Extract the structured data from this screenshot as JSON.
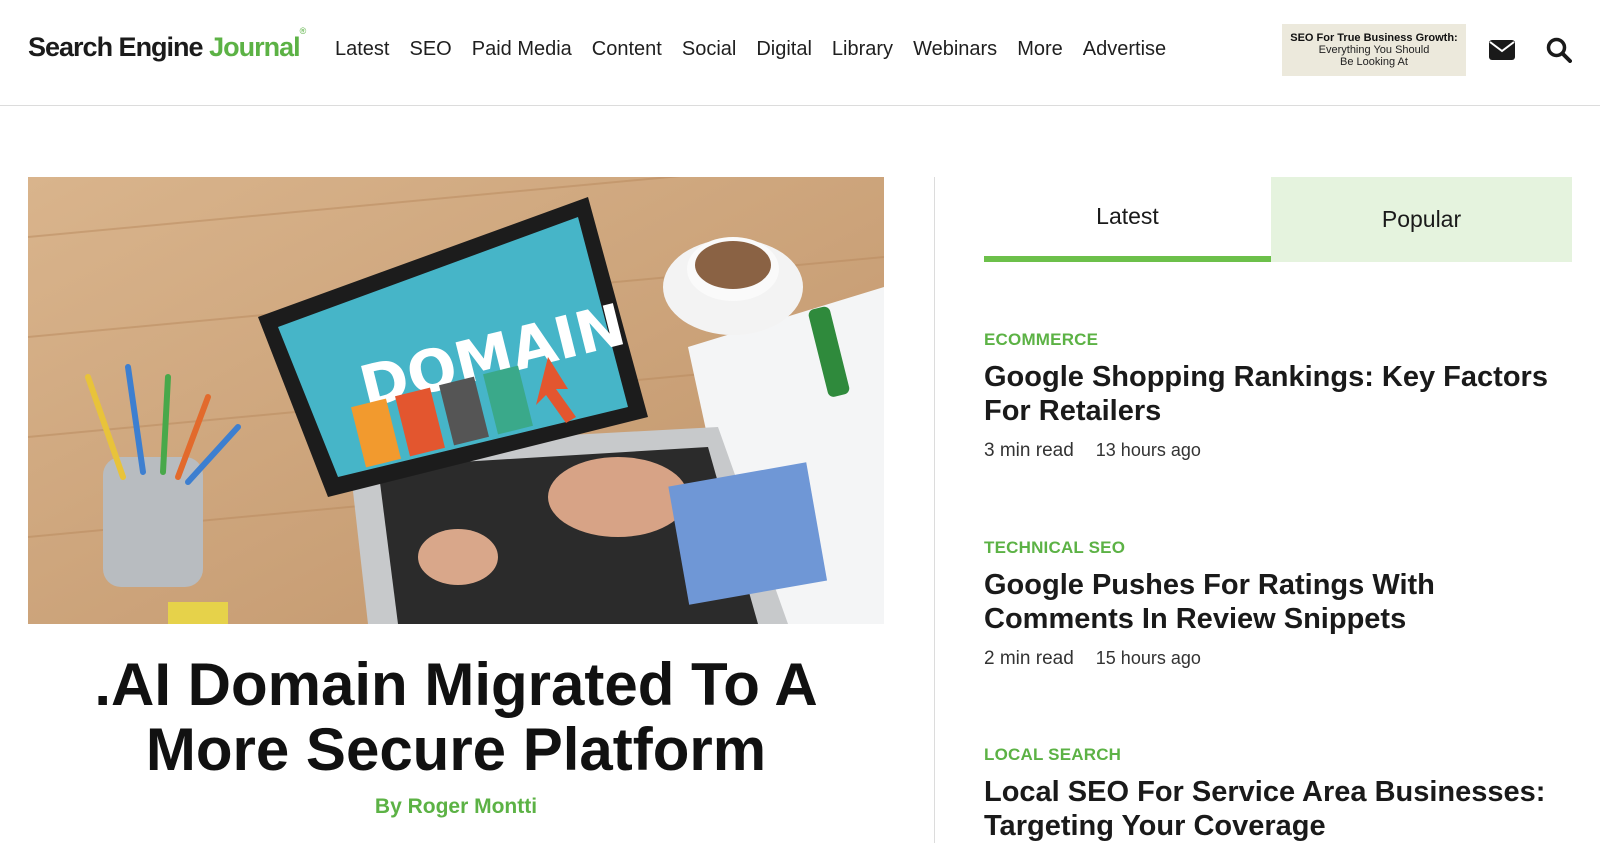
{
  "header": {
    "logo": {
      "part1": "Search Engine ",
      "part2": "Journal",
      "mark": "®"
    },
    "nav": [
      "Latest",
      "SEO",
      "Paid Media",
      "Content",
      "Social",
      "Digital",
      "Library",
      "Webinars",
      "More",
      "Advertise"
    ],
    "promo": {
      "line1": "SEO For True Business Growth:",
      "line2": "Everything You Should",
      "line3": "Be Looking At"
    },
    "icons": [
      "envelope-icon",
      "search-icon"
    ]
  },
  "hero": {
    "image_text": "DOMAIN",
    "title": ".AI Domain Migrated To A More Secure Platform",
    "byline": "By Roger Montti"
  },
  "tabs": {
    "latest": "Latest",
    "popular": "Popular"
  },
  "articles": [
    {
      "category": "ECOMMERCE",
      "title": "Google Shopping Rankings: Key Factors For Retailers",
      "read": "3 min read",
      "ago": "13 hours ago"
    },
    {
      "category": "TECHNICAL SEO",
      "title": "Google Pushes For Ratings With Comments In Review Snippets",
      "read": "2 min read",
      "ago": "15 hours ago"
    },
    {
      "category": "LOCAL SEARCH",
      "title": "Local SEO For Service Area Businesses: Targeting Your Coverage"
    }
  ],
  "colors": {
    "brand_green": "#5cb245",
    "tab_active_bar": "#6cc04a",
    "tab_popular_bg": "#e5f3de"
  }
}
